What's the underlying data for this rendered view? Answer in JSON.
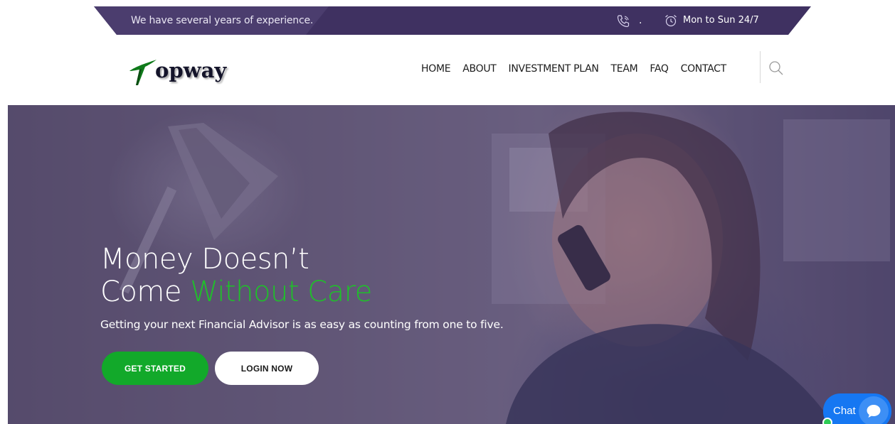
{
  "topbar": {
    "tagline": "We have several years of experience.",
    "phone_icon": "phone-icon",
    "phone_text": ".",
    "clock_icon": "alarm-clock-icon",
    "hours": "Mon to Sun 24/7",
    "bg_color": "#3f3161"
  },
  "logo": {
    "text": "opway",
    "mark_icon": "topway-arrow-logo",
    "mark_color": "#0f7a1a"
  },
  "nav": {
    "items": [
      "HOME",
      "ABOUT",
      "INVESTMENT PLAN",
      "TEAM",
      "FAQ",
      "CONTACT"
    ],
    "search_icon": "search-icon"
  },
  "hero": {
    "title_line1": "Money Doesn’t",
    "title_line2_plain": "Come",
    "title_line2_accent": "Without Care",
    "subtitle": "Getting your next Financial Advisor is as easy as counting from one to five.",
    "primary_button": "GET STARTED",
    "secondary_button": "LOGIN NOW",
    "accent_color": "#1fc02a",
    "primary_color": "#12a92a"
  },
  "chat": {
    "label": "Chat",
    "icon": "chat-bubble-icon",
    "color": "#1677f2",
    "status_color": "#2ecc55"
  }
}
